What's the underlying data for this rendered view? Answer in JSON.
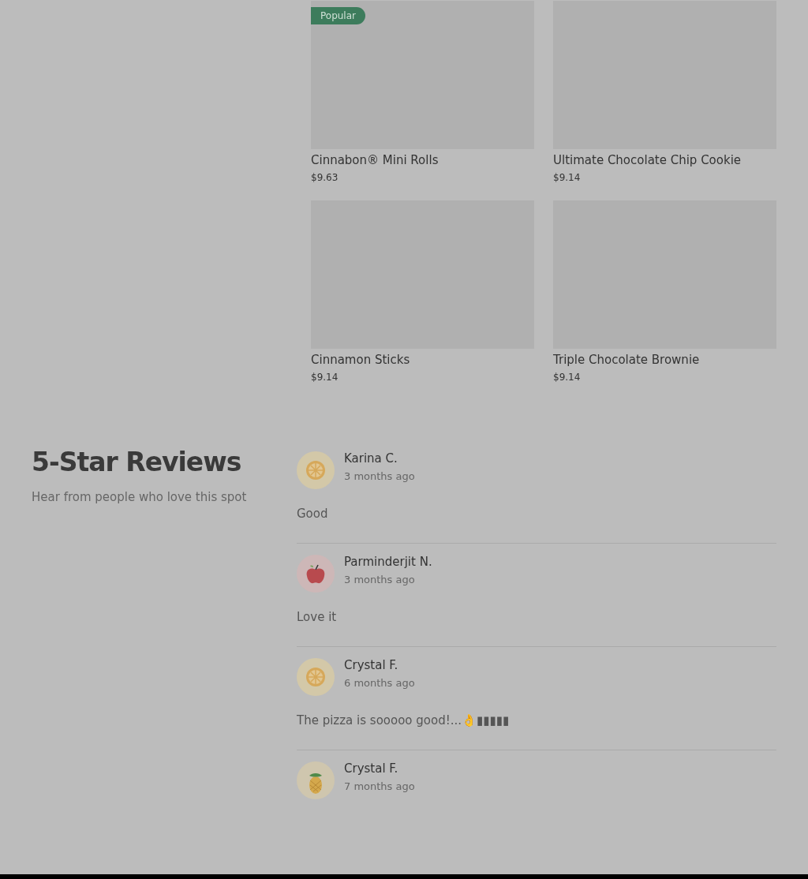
{
  "products": [
    {
      "name": "Cinnabon® Mini Rolls",
      "price": "$9.63",
      "badge": "Popular"
    },
    {
      "name": "Ultimate Chocolate Chip Cookie",
      "price": "$9.14"
    },
    {
      "name": "Cinnamon Sticks",
      "price": "$9.14"
    },
    {
      "name": "Triple Chocolate Brownie",
      "price": "$9.14"
    }
  ],
  "reviews_section": {
    "title": "5-Star Reviews",
    "subtitle": "Hear from people who love this spot"
  },
  "reviews": [
    {
      "kind": "citrus",
      "name": "Karina C.",
      "time": "3 months ago",
      "text": "Good"
    },
    {
      "kind": "apple",
      "name": "Parminderjit N.",
      "time": "3 months ago",
      "text": "Love it"
    },
    {
      "kind": "citrus",
      "name": "Crystal F.",
      "time": "6 months ago",
      "text": "The pizza is sooooo good!...👌▮▮▮▮▮"
    },
    {
      "kind": "pineapple",
      "name": "Crystal F.",
      "time": "7 months ago"
    }
  ]
}
